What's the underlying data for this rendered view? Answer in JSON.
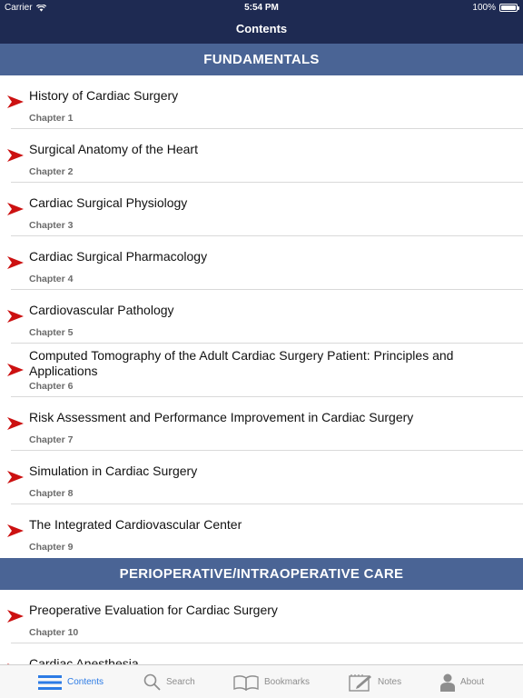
{
  "status_bar": {
    "carrier": "Carrier",
    "time": "5:54 PM",
    "battery": "100%"
  },
  "nav": {
    "title": "Contents"
  },
  "sections": [
    {
      "title": "FUNDAMENTALS",
      "items": [
        {
          "title": "History of Cardiac Surgery",
          "chapter": "Chapter 1"
        },
        {
          "title": "Surgical Anatomy of the Heart",
          "chapter": "Chapter 2"
        },
        {
          "title": "Cardiac Surgical Physiology",
          "chapter": "Chapter 3"
        },
        {
          "title": "Cardiac Surgical Pharmacology",
          "chapter": "Chapter 4"
        },
        {
          "title": "Cardiovascular Pathology",
          "chapter": "Chapter 5"
        },
        {
          "title": "Computed Tomography of the Adult Cardiac Surgery Patient: Principles and Applications",
          "chapter": "Chapter 6"
        },
        {
          "title": "Risk Assessment and Performance Improvement in Cardiac Surgery",
          "chapter": "Chapter 7"
        },
        {
          "title": "Simulation in Cardiac Surgery",
          "chapter": "Chapter 8"
        },
        {
          "title": "The Integrated Cardiovascular Center",
          "chapter": "Chapter 9"
        }
      ]
    },
    {
      "title": "PERIOPERATIVE/INTRAOPERATIVE CARE",
      "items": [
        {
          "title": "Preoperative Evaluation for Cardiac Surgery",
          "chapter": "Chapter 10"
        },
        {
          "title": "Cardiac Anesthesia",
          "chapter": ""
        }
      ]
    }
  ],
  "tabs": [
    {
      "label": "Contents",
      "icon": "list-icon",
      "active": true
    },
    {
      "label": "Search",
      "icon": "search-icon",
      "active": false
    },
    {
      "label": "Bookmarks",
      "icon": "book-icon",
      "active": false
    },
    {
      "label": "Notes",
      "icon": "notes-icon",
      "active": false
    },
    {
      "label": "About",
      "icon": "person-icon",
      "active": false
    }
  ],
  "colors": {
    "nav_bg": "#1e2a52",
    "section_bg": "#4a6495",
    "arrow": "#cc1111",
    "tab_active": "#2c7be5",
    "tab_inactive": "#8e8e8e"
  }
}
